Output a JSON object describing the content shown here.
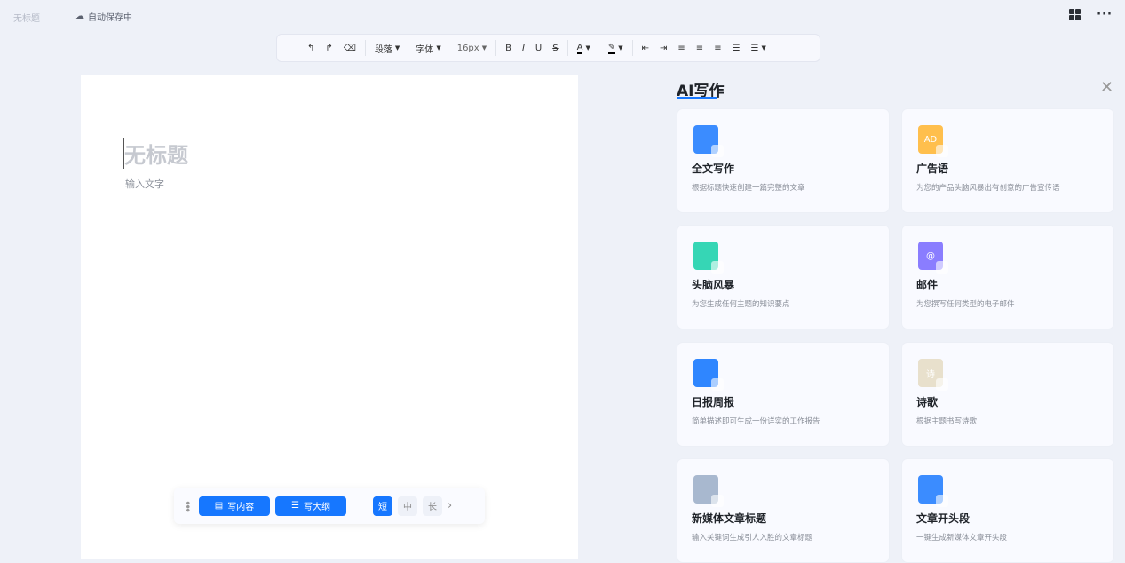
{
  "header": {
    "doc_title": "无标题",
    "autosave": "自动保存中"
  },
  "toolbar": {
    "paragraph": "段落",
    "font": "字体",
    "size": "16px",
    "bold": "B",
    "italic": "I",
    "underline": "U",
    "strike": "S",
    "font_color": "A"
  },
  "doc": {
    "title_placeholder": "无标题",
    "body_placeholder": "输入文字"
  },
  "bottom_bar": {
    "write_content": "写内容",
    "write_outline": "写大纲",
    "lengths": [
      "短",
      "中",
      "长"
    ],
    "selected_length": "短"
  },
  "panel": {
    "title": "AI写作",
    "cards": [
      {
        "title": "全文写作",
        "desc": "根据标题快速创建一篇完整的文章",
        "icon": "document-edit-icon",
        "color": "#3b8cff"
      },
      {
        "title": "广告语",
        "desc": "为您的产品头脑风暴出有创意的广告宣传语",
        "icon": "ad-icon",
        "color": "#ffbf4d",
        "icon_text": "AD"
      },
      {
        "title": "头脑风暴",
        "desc": "为您生成任何主题的知识要点",
        "icon": "mindmap-icon",
        "color": "#36d6b5"
      },
      {
        "title": "邮件",
        "desc": "为您撰写任何类型的电子邮件",
        "icon": "mail-icon",
        "color": "#8a7dff",
        "icon_text": "@"
      },
      {
        "title": "日报周报",
        "desc": "简单描述即可生成一份详实的工作报告",
        "icon": "report-icon",
        "color": "#2f86ff"
      },
      {
        "title": "诗歌",
        "desc": "根据主题书写诗歌",
        "icon": "poem-icon",
        "color": "#e8e0cc",
        "icon_text": "诗"
      },
      {
        "title": "新媒体文章标题",
        "desc": "输入关键词生成引人入胜的文章标题",
        "icon": "media-title-icon",
        "color": "#a8b8cf"
      },
      {
        "title": "文章开头段",
        "desc": "一键生成新媒体文章开头段",
        "icon": "article-opening-icon",
        "color": "#3b8cff"
      }
    ]
  }
}
